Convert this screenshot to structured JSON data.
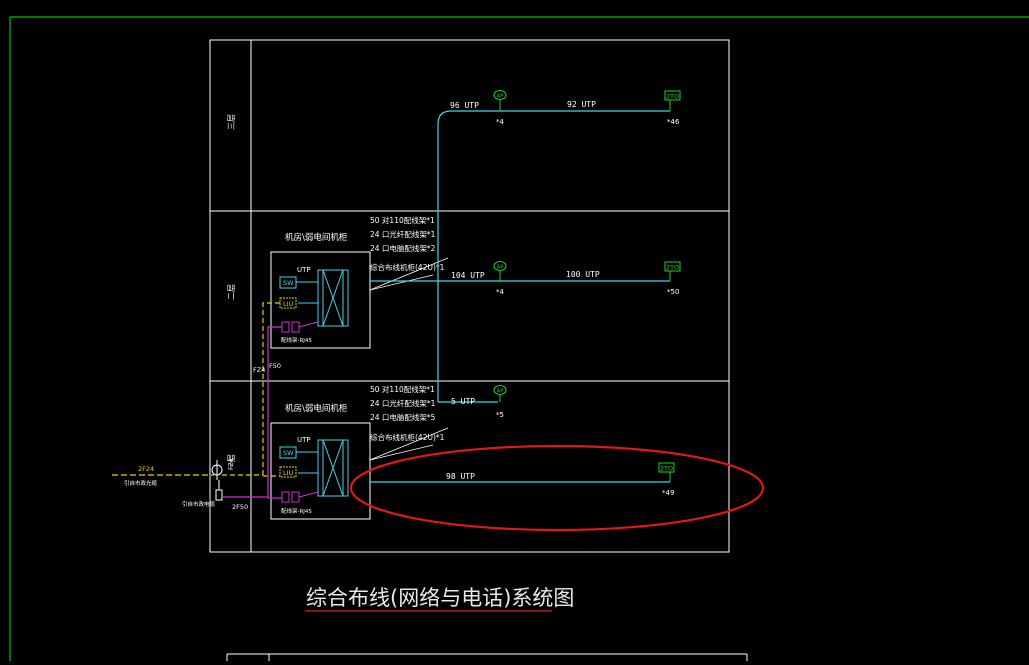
{
  "title": "综合布线(网络与电话)系统图",
  "floors": {
    "top": "三层",
    "middle": "二层",
    "bottom": "一层"
  },
  "cabinet_title": "机房\\弱电间机柜",
  "cabinet2": {
    "spec1": "50 对110配线架*1",
    "spec2": "24 口光纤配线架*1",
    "spec3": "24 口电脑配线架*2",
    "rack": "综合布线机柜(42U)*1"
  },
  "cabinet1": {
    "spec1": "50 对110配线架*1",
    "spec2": "24 口光纤配线架*1",
    "spec3": "24 口电脑配线架*5",
    "rack": "综合布线机柜(42U)*1"
  },
  "inner": {
    "sw": "SW",
    "utp": "UTP",
    "liu": "LIU",
    "patch": "配线架-RJ45"
  },
  "riser": {
    "fiber": "FZ4",
    "copper": "F50"
  },
  "incoming": {
    "line": "2F24",
    "label1": "引自市政光缆",
    "label2": "引自市政电缆",
    "line2": "2F50"
  },
  "runs": {
    "f3_left": "96 UTP",
    "f3_right": "92 UTP",
    "f3_ap_count": "*4",
    "f3_outlet_count": "*46",
    "f2_left": "104 UTP",
    "f2_right": "100 UTP",
    "f2_ap_count": "*4",
    "f2_outlet_count": "*50",
    "f1_ap": "5 UTP",
    "f1_ap_count": "*5",
    "f1_main": "98 UTP",
    "f1_outlet_count": "*49"
  },
  "symbols": {
    "ap": "AP",
    "outlet": "2TO"
  },
  "colors": {
    "frame": "#00c000",
    "grid": "#ffffff",
    "cyan": "#3fd6e6",
    "magenta": "#d030d0",
    "yellow": "#e6d200",
    "green": "#22d022",
    "highlight": "#e01818",
    "title": "#e8e8e8"
  }
}
